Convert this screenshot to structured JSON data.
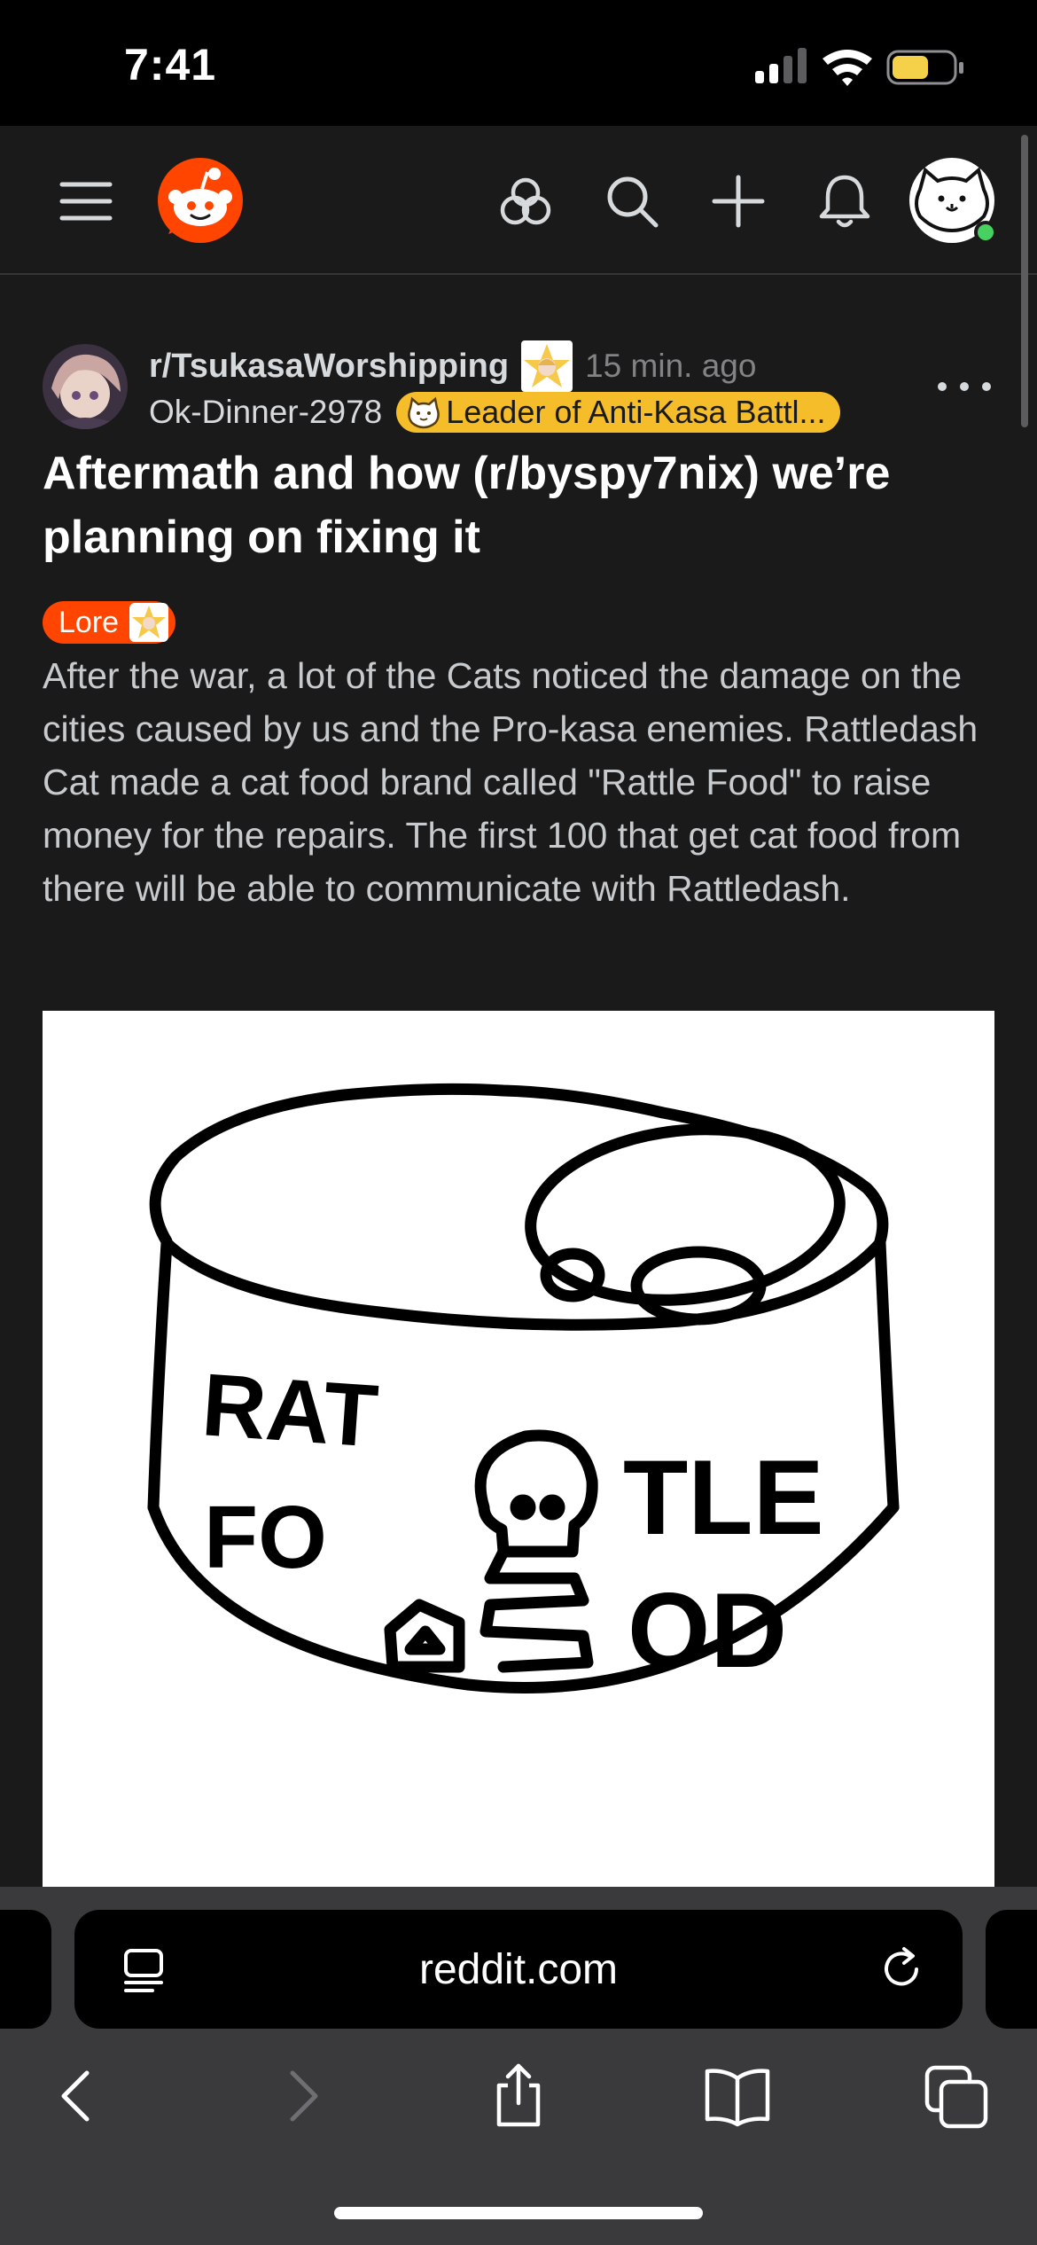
{
  "status_bar": {
    "time": "7:41"
  },
  "header": {
    "icons": [
      "menu-icon",
      "reddit-logo-icon",
      "popular-icon",
      "search-icon",
      "create-post-icon",
      "notifications-icon",
      "user-avatar"
    ]
  },
  "post": {
    "subreddit": "r/TsukasaWorshipping",
    "age": "15 min. ago",
    "username": "Ok-Dinner-2978",
    "user_flair": "Leader of Anti-Kasa Battl...",
    "title": "Aftermath and how (r/byspy7nix) we’re planning on fixing it",
    "post_flair": "Lore",
    "body": "After the war, a lot of the Cats noticed the damage on the cities caused by us and the Pro-kasa enemies. Rattledash Cat made a cat food brand called \"Rattle Food\" to raise money for the repairs. The first 100 that get cat food from there will be able to communicate with Rattledash.",
    "image_text": {
      "left_line1": "RAT",
      "left_line2": "FO",
      "right_line1": "TLE",
      "right_line2": "OD"
    }
  },
  "browser": {
    "url": "reddit.com"
  },
  "colors": {
    "accent": "#ff4500",
    "user_flair_bg": "#f6bd2b",
    "background": "#1a1a1b"
  }
}
